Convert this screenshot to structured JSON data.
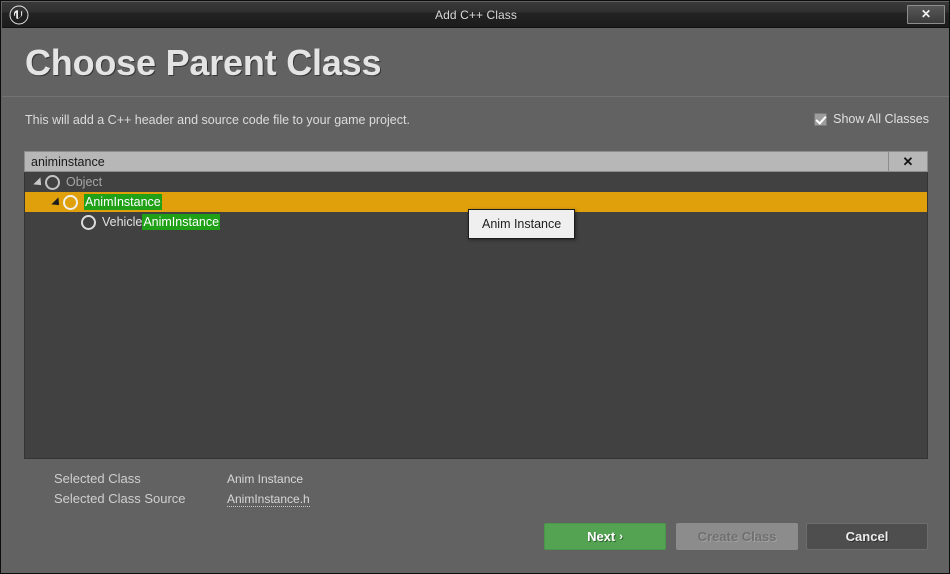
{
  "window": {
    "title": "Add C++ Class",
    "logo_icon": "unreal-engine-logo",
    "close_label": "✕"
  },
  "header": {
    "page_title": "Choose Parent Class",
    "description": "This will add a C++ header and source code file to your game project.",
    "show_all_classes": {
      "label": "Show All Classes",
      "checked": true
    }
  },
  "search": {
    "value": "animinstance",
    "placeholder": "Search Classes",
    "clear_icon": "✕"
  },
  "tree": {
    "rows": [
      {
        "label": "Object",
        "prefix": "Object",
        "highlight": "",
        "indent": 8,
        "expandable": true,
        "expanded": true,
        "selected": false,
        "dim": true
      },
      {
        "label": "AnimInstance",
        "prefix": "",
        "highlight": "AnimInstance",
        "indent": 26,
        "expandable": true,
        "expanded": true,
        "selected": true,
        "dim": false
      },
      {
        "label": "VehicleAnimInstance",
        "prefix": "Vehicle",
        "highlight": "AnimInstance",
        "indent": 44,
        "expandable": false,
        "expanded": false,
        "selected": false,
        "dim": false
      }
    ]
  },
  "tooltip": {
    "text": "Anim Instance"
  },
  "info": {
    "selected_class_label": "Selected Class",
    "selected_class_value": "Anim Instance",
    "selected_source_label": "Selected Class Source",
    "selected_source_value": "AnimInstance.h"
  },
  "footer": {
    "next_label": "Next",
    "next_chevron": "›",
    "create_label": "Create Class",
    "cancel_label": "Cancel"
  },
  "colors": {
    "accent_orange": "#e0a00c",
    "match_green": "#1fa017",
    "next_green": "#53a352",
    "window_bg": "#626262",
    "list_bg": "#414141"
  }
}
